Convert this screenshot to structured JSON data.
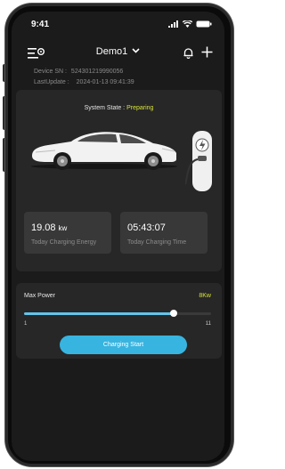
{
  "status_bar": {
    "time": "9:41"
  },
  "nav": {
    "title": "Demo1"
  },
  "device": {
    "sn_label": "Device SN :",
    "sn_value": "524301219990056",
    "update_label": "LastUpdate :",
    "update_value": "2024-01-13 09:41:39"
  },
  "state": {
    "label": "System State :",
    "value": "Preparing"
  },
  "tiles": {
    "energy": {
      "value": "19.08",
      "unit": "kw",
      "label": "Today Charging Energy"
    },
    "time": {
      "value": "05:43:07",
      "label": "Today Charging Time"
    }
  },
  "power": {
    "label": "Max Power",
    "value": "8Kw",
    "min_label": "1",
    "max_label": "11",
    "level": 0.8
  },
  "button": {
    "start": "Charging Start"
  },
  "colors": {
    "accent": "#38b4e0",
    "state": "#d8e33a",
    "card": "#272727",
    "tile": "#383838"
  }
}
